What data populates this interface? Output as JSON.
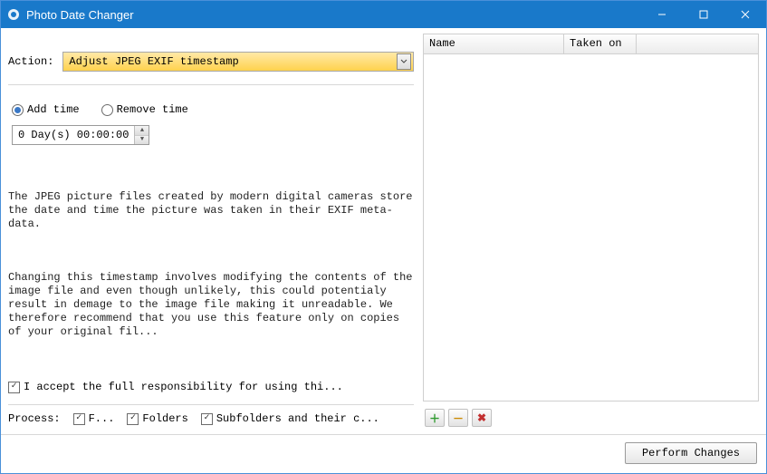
{
  "titlebar": {
    "title": "Photo Date Changer"
  },
  "left": {
    "action_label": "Action:",
    "action_value": "Adjust JPEG EXIF timestamp",
    "radio_add": "Add time",
    "radio_remove": "Remove time",
    "time_value": "0 Day(s) 00:00:00",
    "desc_p1": "The JPEG picture files created by modern digital cameras store the date and time the picture was taken in their EXIF meta-data.",
    "desc_p2": "Changing this timestamp involves modifying the contents of the image file and even though unlikely, this could potentialy result in demage to the image file making it unreadable. We therefore recommend that you use this feature only on copies of your original fil...",
    "accept_label": "I accept the full responsibility for using thi...",
    "process_label": "Process:",
    "process_opts": [
      "F...",
      "Folders",
      "Subfolders and their c..."
    ]
  },
  "table": {
    "cols": [
      "Name",
      "Taken on",
      ""
    ]
  },
  "toolbar": {
    "add": "＋",
    "remove": "－",
    "delete": "✖"
  },
  "footer": {
    "perform": "Perform Changes"
  },
  "colors": {
    "accent": "#1979ca",
    "action_bg_top": "#ffe9a8",
    "action_bg_bot": "#ffd24d"
  }
}
